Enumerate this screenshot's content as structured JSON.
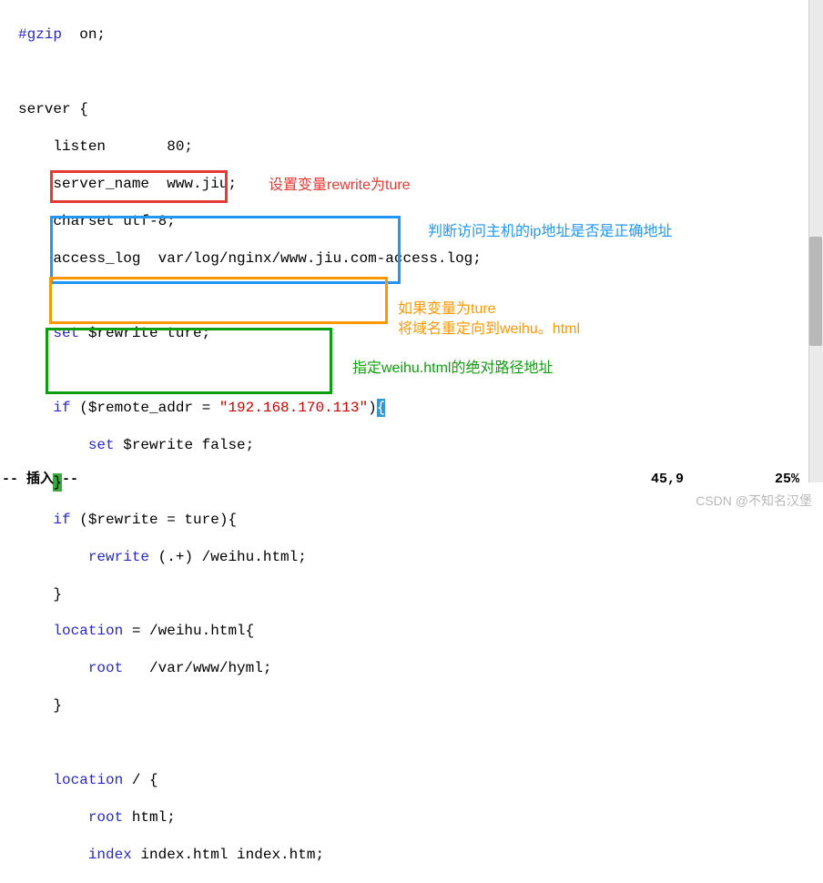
{
  "code": {
    "l1a": "#gzip",
    "l1b": "  on;",
    "l2": "",
    "l3": "server {",
    "l4": "    listen       80;",
    "l5": "    server_name  www.jiu;",
    "l6": "    charset utf-8;",
    "l7": "    access_log  var/log/nginx/www.jiu.com-access.log;",
    "l8": "",
    "l9a": "    set",
    "l9b": " $rewrite ture;",
    "l10": "",
    "l11a": "    if",
    "l11b": " ($remote_addr = ",
    "l11c": "\"192.168.170.113\"",
    "l11d": ")",
    "l11e": "{",
    "l12a": "        set",
    "l12b": " $rewrite false;",
    "l13": "    ",
    "l13b": "}",
    "l14a": "    if",
    "l14b": " ($rewrite = ture){",
    "l15a": "        rewrite",
    "l15b": " (.+) /weihu.html;",
    "l16": "    }",
    "l17a": "    location",
    "l17b": " = /weihu.html{",
    "l18a": "        root",
    "l18b": "   /var/www/hyml;",
    "l19": "    }",
    "l20": "",
    "l21a": "    location",
    "l21b": " / {",
    "l22a": "        root",
    "l22b": " html;",
    "l23a": "        index",
    "l23b": " index.html index.htm;"
  },
  "annotations": {
    "red": "设置变量rewrite为ture",
    "blue": "判断访问主机的ip地址是否是正确地址",
    "orange1": "如果变量为ture",
    "orange2": "将域名重定向到weihu。html",
    "green": "指定weihu.html的绝对路径地址"
  },
  "status": {
    "mode": "-- 插入 --",
    "position": "45,9",
    "percent": "25%"
  },
  "watermark": "CSDN @不知名汉堡"
}
